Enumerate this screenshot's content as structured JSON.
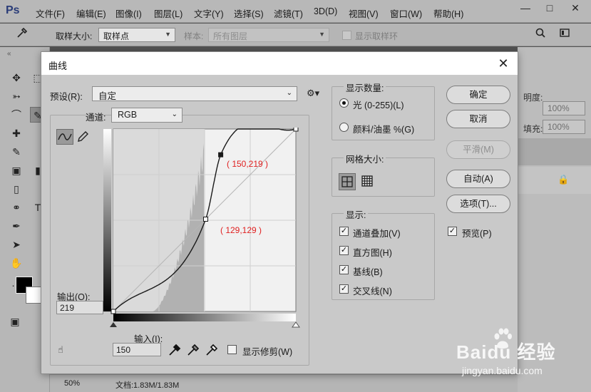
{
  "app": {
    "logo": "Ps",
    "menu": [
      "文件(F)",
      "编辑(E)",
      "图像(I)",
      "图层(L)",
      "文字(Y)",
      "选择(S)",
      "滤镜(T)",
      "3D(D)",
      "视图(V)",
      "窗口(W)",
      "帮助(H)"
    ]
  },
  "options_bar": {
    "sample_size_label": "取样大小:",
    "sample_size_value": "取样点",
    "sample_label": "样本:",
    "sample_value": "所有图层",
    "show_ring_label": "显示取样环"
  },
  "right_panel": {
    "opacity_label": "明度:",
    "opacity_value": "100%",
    "fill_label": "填充:",
    "fill_value": "100%"
  },
  "status_bar": {
    "zoom": "50%",
    "doc_info": "文档:1.83M/1.83M"
  },
  "dialog": {
    "title": "曲线",
    "preset_label": "预设(R):",
    "preset_value": "自定",
    "channel_label": "通道:",
    "channel_value": "RGB",
    "output_label": "输出(O):",
    "output_value": "219",
    "input_label": "输入(I):",
    "input_value": "150",
    "show_clipping_label": "显示修剪(W)",
    "display_amount": {
      "title": "显示数量:",
      "options": [
        "光 (0-255)(L)",
        "颜料/油墨 %(G)"
      ],
      "selected": 0
    },
    "grid_size": {
      "title": "网格大小:"
    },
    "show": {
      "title": "显示:",
      "options": [
        {
          "label": "通道叠加(V)",
          "checked": true
        },
        {
          "label": "直方图(H)",
          "checked": true
        },
        {
          "label": "基线(B)",
          "checked": true
        },
        {
          "label": "交叉线(N)",
          "checked": true
        }
      ]
    },
    "buttons": {
      "ok": "确定",
      "cancel": "取消",
      "smooth": "平滑(M)",
      "auto": "自动(A)",
      "options": "选项(T)..."
    },
    "preview_label": "预览(P)",
    "preview_checked": true,
    "curve_points": [
      {
        "input": 0,
        "output": 0
      },
      {
        "input": 129,
        "output": 129
      },
      {
        "input": 150,
        "output": 219
      },
      {
        "input": 255,
        "output": 255
      }
    ],
    "annotations": [
      {
        "text": "( 150,219 )",
        "color": "#e02020"
      },
      {
        "text": "( 129,129 )",
        "color": "#e02020"
      }
    ]
  },
  "watermark": {
    "brand": "Baidu 经验",
    "url": "jingyan.baidu.com"
  }
}
